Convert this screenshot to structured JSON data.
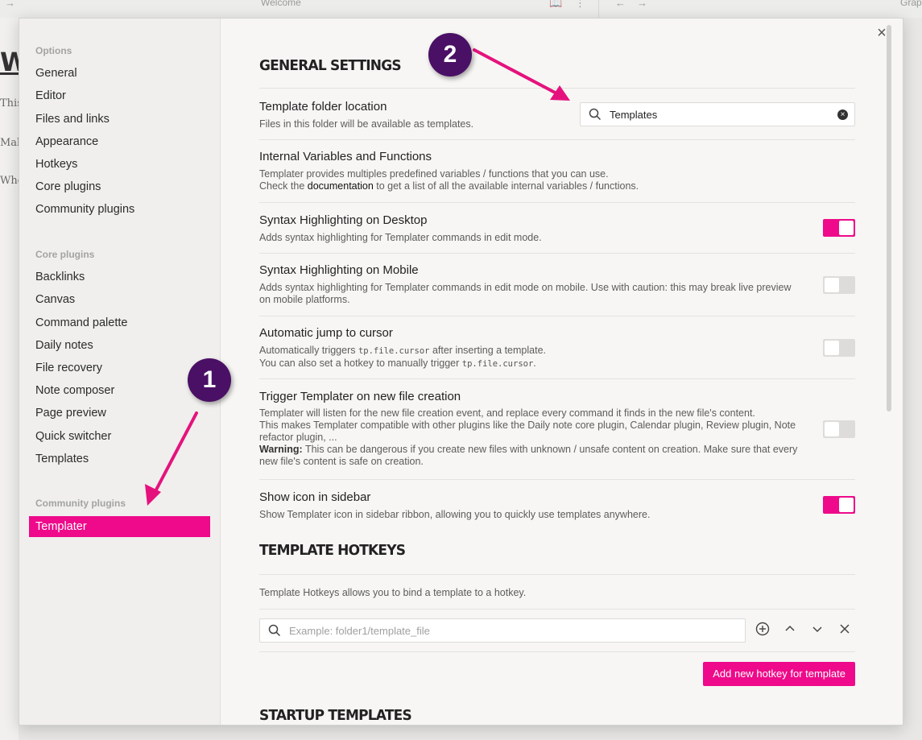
{
  "background": {
    "tab_title": "Welcome",
    "right_tab": "Grap",
    "heading_fragment": "W",
    "text_fragments": [
      "This",
      "Mak",
      "Whe"
    ]
  },
  "sidebar": {
    "options_title": "Options",
    "options": [
      "General",
      "Editor",
      "Files and links",
      "Appearance",
      "Hotkeys",
      "Core plugins",
      "Community plugins"
    ],
    "core_title": "Core plugins",
    "core": [
      "Backlinks",
      "Canvas",
      "Command palette",
      "Daily notes",
      "File recovery",
      "Note composer",
      "Page preview",
      "Quick switcher",
      "Templates"
    ],
    "community_title": "Community plugins",
    "community_active": "Templater"
  },
  "general": {
    "heading": "GENERAL SETTINGS",
    "folder": {
      "name": "Template folder location",
      "desc": "Files in this folder will be available as templates.",
      "value": "Templates"
    },
    "internal": {
      "name": "Internal Variables and Functions",
      "desc1": "Templater provides multiples predefined variables / functions that you can use.",
      "desc2_pre": "Check the ",
      "desc2_link": "documentation",
      "desc2_post": " to get a list of all the available internal variables / functions."
    },
    "syntax_desktop": {
      "name": "Syntax Highlighting on Desktop",
      "desc": "Adds syntax highlighting for Templater commands in edit mode.",
      "enabled": true
    },
    "syntax_mobile": {
      "name": "Syntax Highlighting on Mobile",
      "desc1": "Adds syntax highlighting for Templater commands in edit mode on mobile. Use with caution: this may break live preview",
      "desc2": "on mobile platforms.",
      "enabled": false
    },
    "auto_jump": {
      "name": "Automatic jump to cursor",
      "desc1_pre": "Automatically triggers ",
      "desc1_code": "tp.file.cursor",
      "desc1_post": " after inserting a template.",
      "desc2_pre": "You can also set a hotkey to manually trigger ",
      "desc2_code": "tp.file.cursor",
      "desc2_post": ".",
      "enabled": false
    },
    "trigger": {
      "name": "Trigger Templater on new file creation",
      "desc1": "Templater will listen for the new file creation event, and replace every command it finds in the new file's content.",
      "desc2": "This makes Templater compatible with other plugins like the Daily note core plugin, Calendar plugin, Review plugin, Note",
      "desc3": "refactor plugin, ...",
      "warning_label": "Warning:",
      "warning_text": " This can be dangerous if you create new files with unknown / unsafe content on creation. Make sure that every",
      "desc5": "new file's content is safe on creation.",
      "enabled": false
    },
    "show_icon": {
      "name": "Show icon in sidebar",
      "desc": "Show Templater icon in sidebar ribbon, allowing you to quickly use templates anywhere.",
      "enabled": true
    }
  },
  "hotkeys": {
    "heading": "TEMPLATE HOTKEYS",
    "desc": "Template Hotkeys allows you to bind a template to a hotkey.",
    "placeholder": "Example: folder1/template_file",
    "add_button": "Add new hotkey for template"
  },
  "startup": {
    "heading": "STARTUP TEMPLATES"
  },
  "annotations": {
    "badge1": "1",
    "badge2": "2",
    "badge_color": "#4a1065",
    "arrow_color": "#e5127d"
  },
  "colors": {
    "accent": "#ee0a8a"
  }
}
